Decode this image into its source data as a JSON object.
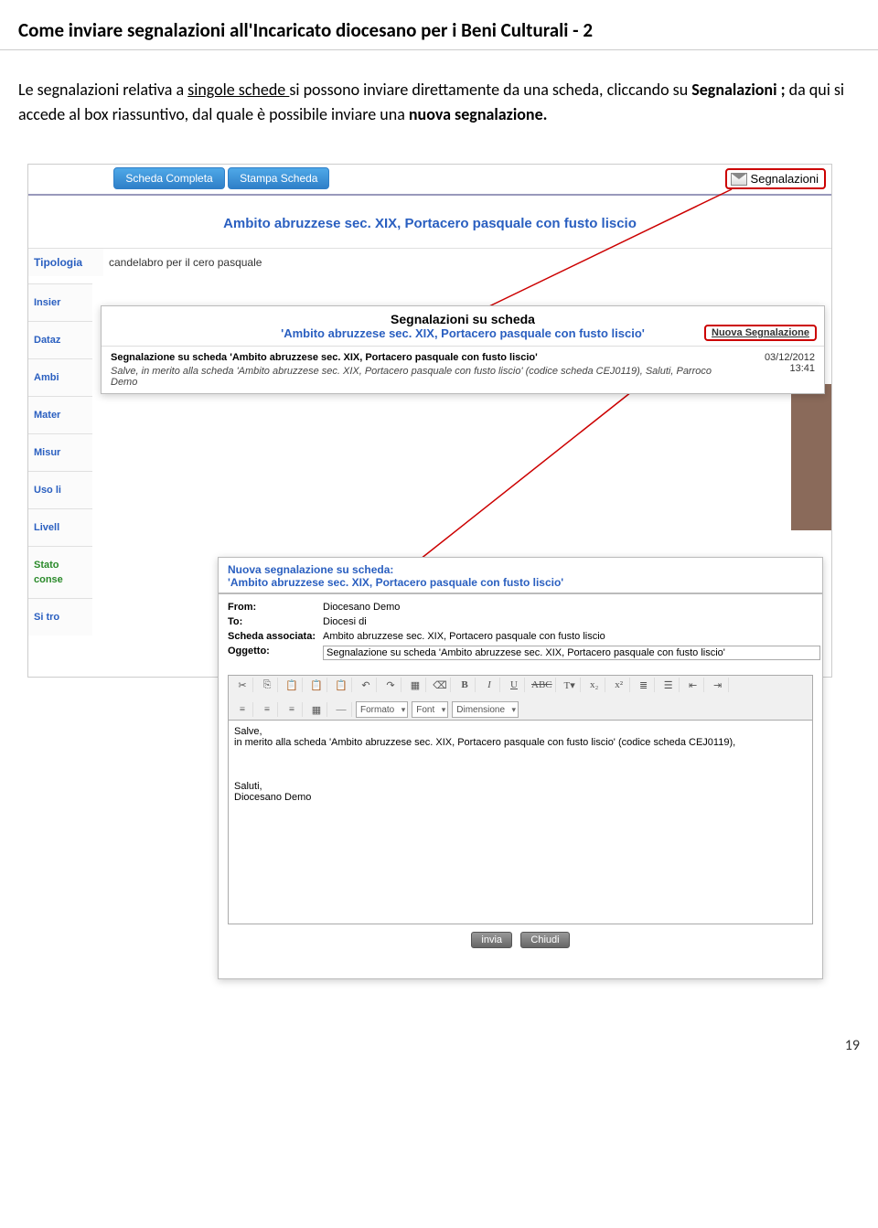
{
  "page": {
    "title": "Come inviare segnalazioni all'Incaricato diocesano per i Beni Culturali - 2",
    "body_pre": "Le segnalazioni relativa a ",
    "body_underline": "singole schede ",
    "body_mid": "si possono inviare direttamente da una scheda, cliccando su ",
    "body_bold": "Segnalazioni ; ",
    "body_post": "da qui si accede al box riassuntivo, dal quale è possibile inviare una ",
    "body_bold2": "nuova segnalazione.",
    "page_number": "19"
  },
  "base": {
    "btn_completa": "Scheda Completa",
    "btn_stampa": "Stampa Scheda",
    "segnalazioni": "Segnalazioni",
    "title": "Ambito abruzzese sec. XIX, Portacero pasquale con fusto liscio",
    "tipologia_label": "Tipologia",
    "tipologia_value": "candelabro per il cero pasquale",
    "labels": [
      "Insier",
      "Dataz",
      "Ambi",
      "Mater",
      "Misur",
      "Uso li",
      "Livell",
      "Stato",
      "conse",
      "Si tro"
    ]
  },
  "popup1": {
    "title": "Segnalazioni su scheda",
    "subtitle": "'Ambito abruzzese sec. XIX, Portacero pasquale con fusto liscio'",
    "nuova": "Nuova Segnalazione",
    "subject_bold": "Segnalazione su scheda 'Ambito abruzzese sec. XIX, Portacero pasquale con fusto liscio'",
    "subject_italic": "Salve, in merito alla scheda 'Ambito abruzzese sec. XIX, Portacero pasquale con fusto liscio' (codice scheda CEJ0119), Saluti, Parroco Demo",
    "date": "03/12/2012",
    "time": "13:41"
  },
  "popup2": {
    "header_a": "Nuova segnalazione su scheda:",
    "header_b": "'Ambito abruzzese sec. XIX, Portacero pasquale con fusto liscio'",
    "from_label": "From:",
    "from_value": "Diocesano Demo",
    "to_label": "To:",
    "to_value": "Diocesi di",
    "assoc_label": "Scheda associata:",
    "assoc_value": "Ambito abruzzese sec. XIX, Portacero pasquale con fusto liscio",
    "ogg_label": "Oggetto:",
    "ogg_value": "Segnalazione su scheda 'Ambito abruzzese sec. XIX, Portacero pasquale con fusto liscio'",
    "tb_format": "Formato",
    "tb_font": "Font",
    "tb_dim": "Dimensione",
    "body_text": "Salve,\nin merito alla scheda 'Ambito abruzzese sec. XIX, Portacero pasquale con fusto liscio' (codice scheda CEJ0119),\n\n\n\nSaluti,\nDiocesano Demo",
    "btn_invia": "invia",
    "btn_chiudi": "Chiudi"
  }
}
